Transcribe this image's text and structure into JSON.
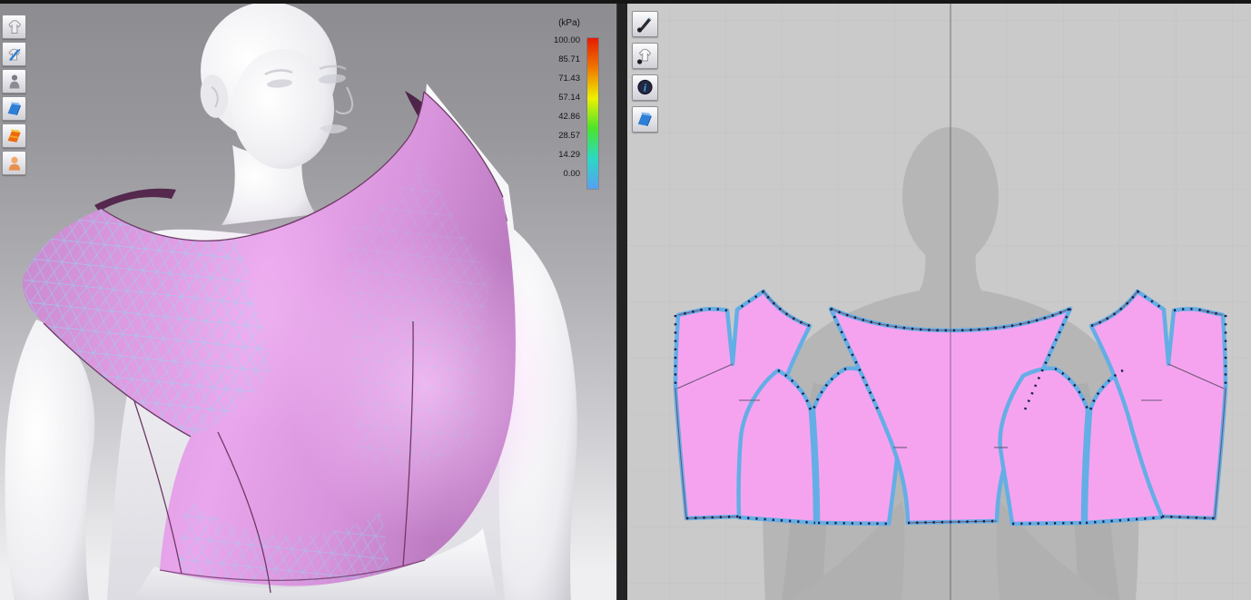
{
  "window": {
    "top_bar_color": "#161616"
  },
  "left_panel": {
    "name": "3D garment viewport",
    "toolbar": {
      "items": [
        {
          "icon": "garment-icon"
        },
        {
          "icon": "garment-edit-icon"
        },
        {
          "icon": "avatar-icon"
        },
        {
          "icon": "fabric-blue-icon"
        },
        {
          "icon": "fabric-orange-icon"
        },
        {
          "icon": "avatar-bust-icon"
        }
      ]
    },
    "legend": {
      "title": "(kPa)",
      "values": [
        "100.00",
        "85.71",
        "71.43",
        "57.14",
        "42.86",
        "28.57",
        "14.29",
        "0.00"
      ],
      "gradient": [
        "#e41c00",
        "#f07800",
        "#eef000",
        "#4ae42c",
        "#2cd8c6",
        "#57a0f2"
      ]
    },
    "colors": {
      "garment_pink": "#dd9ae0",
      "mesh_cyan": "#8fd8f4",
      "seam_dark": "#6e3a66"
    }
  },
  "right_panel": {
    "name": "2D pattern viewport",
    "toolbar": {
      "items": [
        {
          "icon": "pen-tool-icon"
        },
        {
          "icon": "shirt-tool-icon"
        },
        {
          "icon": "info-tool-icon"
        },
        {
          "icon": "fabric-tool-icon"
        }
      ]
    },
    "colors": {
      "background": "#cacaca",
      "grid_line": "#c1c1c1",
      "silhouette": "#b6b6b6",
      "pattern_fill": "#f6a3ef",
      "pattern_outline": "#64aee6",
      "seam_points": "#1b2148"
    }
  }
}
